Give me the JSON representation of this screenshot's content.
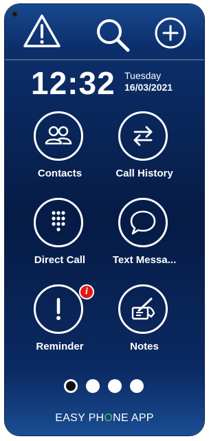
{
  "header": {
    "warning_icon": "warning-triangle-icon",
    "search_icon": "search-icon",
    "add_icon": "plus-circle-icon"
  },
  "clock": {
    "time": "12:32",
    "day": "Tuesday",
    "date": "16/03/2021"
  },
  "tiles": [
    {
      "label": "Contacts",
      "icon": "contacts-icon"
    },
    {
      "label": "Call History",
      "icon": "call-history-icon"
    },
    {
      "label": "Direct Call",
      "icon": "dialpad-icon"
    },
    {
      "label": "Text Messa...",
      "icon": "message-icon"
    },
    {
      "label": "Reminder",
      "icon": "exclamation-icon",
      "badge": "i"
    },
    {
      "label": "Notes",
      "icon": "notes-icon"
    }
  ],
  "pager": {
    "pages": 4,
    "current": 1
  },
  "brand": {
    "before": "EASY PH",
    "o": "O",
    "after": "NE APP"
  },
  "colors": {
    "accent_green": "#4cc36a",
    "badge_red": "#e01818",
    "background": "#061b45"
  }
}
